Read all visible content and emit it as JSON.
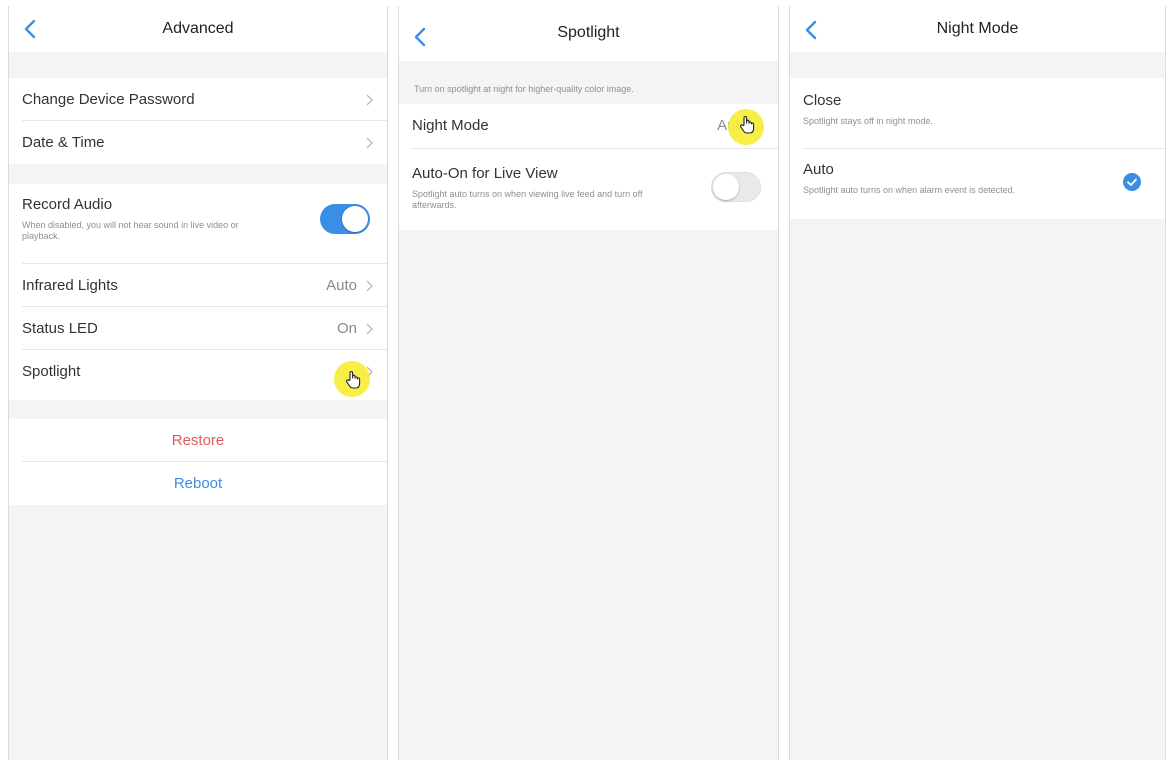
{
  "colors": {
    "accent": "#3b8ee6",
    "restore": "#e05a5a",
    "reboot": "#3b8ee6",
    "highlight": "#f6ee35",
    "background": "#f4f4f6"
  },
  "advanced": {
    "title": "Advanced",
    "back_icon": "chevron-left-icon",
    "items": [
      {
        "label": "Change Device Password",
        "value": "",
        "icon": "chevron-right-icon"
      },
      {
        "label": "Date & Time",
        "value": "",
        "icon": "chevron-right-icon"
      }
    ],
    "record_audio": {
      "label": "Record Audio",
      "description": "When disabled, you will not hear sound in live video or playback.",
      "enabled": true
    },
    "items2": [
      {
        "label": "Infrared Lights",
        "value": "Auto",
        "icon": "chevron-right-icon"
      },
      {
        "label": "Status LED",
        "value": "On",
        "icon": "chevron-right-icon"
      },
      {
        "label": "Spotlight",
        "value": "",
        "icon": "chevron-right-icon"
      }
    ],
    "restore_label": "Restore",
    "reboot_label": "Reboot"
  },
  "spotlight": {
    "title": "Spotlight",
    "back_icon": "chevron-left-icon",
    "hint": "Turn on spotlight at night for higher-quality color image.",
    "night_mode": {
      "label": "Night Mode",
      "value": "Auto"
    },
    "auto_on": {
      "label": "Auto-On for Live View",
      "description": "Spotlight auto turns on when viewing live feed and turn off afterwards.",
      "enabled": false
    }
  },
  "night_mode": {
    "title": "Night Mode",
    "back_icon": "chevron-left-icon",
    "options": [
      {
        "label": "Close",
        "description": "Spotlight stays off in night mode.",
        "selected": false
      },
      {
        "label": "Auto",
        "description": "Spotlight auto turns on when alarm event is detected.",
        "selected": true,
        "icon": "checkmark-icon"
      }
    ]
  }
}
